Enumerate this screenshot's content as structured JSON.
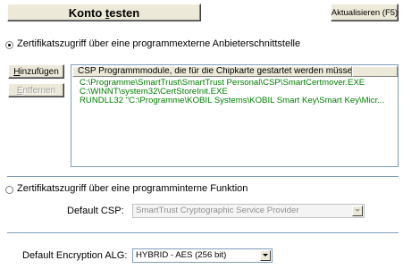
{
  "toolbar": {
    "test_account_prefix": "Konto ",
    "test_account_underlined": "t",
    "test_account_suffix": "esten",
    "refresh_label": "Aktualisieren (F5)"
  },
  "external_section": {
    "radio_label": "Zertifikatszugriff über eine programmexterne Anbieterschnittstelle",
    "selected": true,
    "add_button_prefix": "",
    "add_button_underlined": "H",
    "add_button_suffix": "inzufügen",
    "remove_button_prefix": "",
    "remove_button_underlined": "E",
    "remove_button_suffix": "ntfernen",
    "list_header": "CSP Programmmodule, die für die Chipkarte gestartet werden müssen",
    "list_items": [
      "C:\\Programme\\SmartTrust\\SmartTrust Personal\\CSP\\SmartCertmover.EXE",
      "C:\\WINNT\\system32\\CertStoreInit.EXE",
      "RUNDLL32 \"C:\\Programme\\KOBIL Systems\\KOBIL Smart Key\\Smart Key\\Micr..."
    ]
  },
  "internal_section": {
    "radio_label": "Zertifikatszugriff über eine programminterne Funktion",
    "selected": false,
    "default_csp_label": "Default CSP:",
    "default_csp_value": "SmartTrust Cryptographic Service Provider"
  },
  "encryption": {
    "label": "Default Encryption ALG:",
    "value": "HYBRID - AES (256 bit)"
  }
}
